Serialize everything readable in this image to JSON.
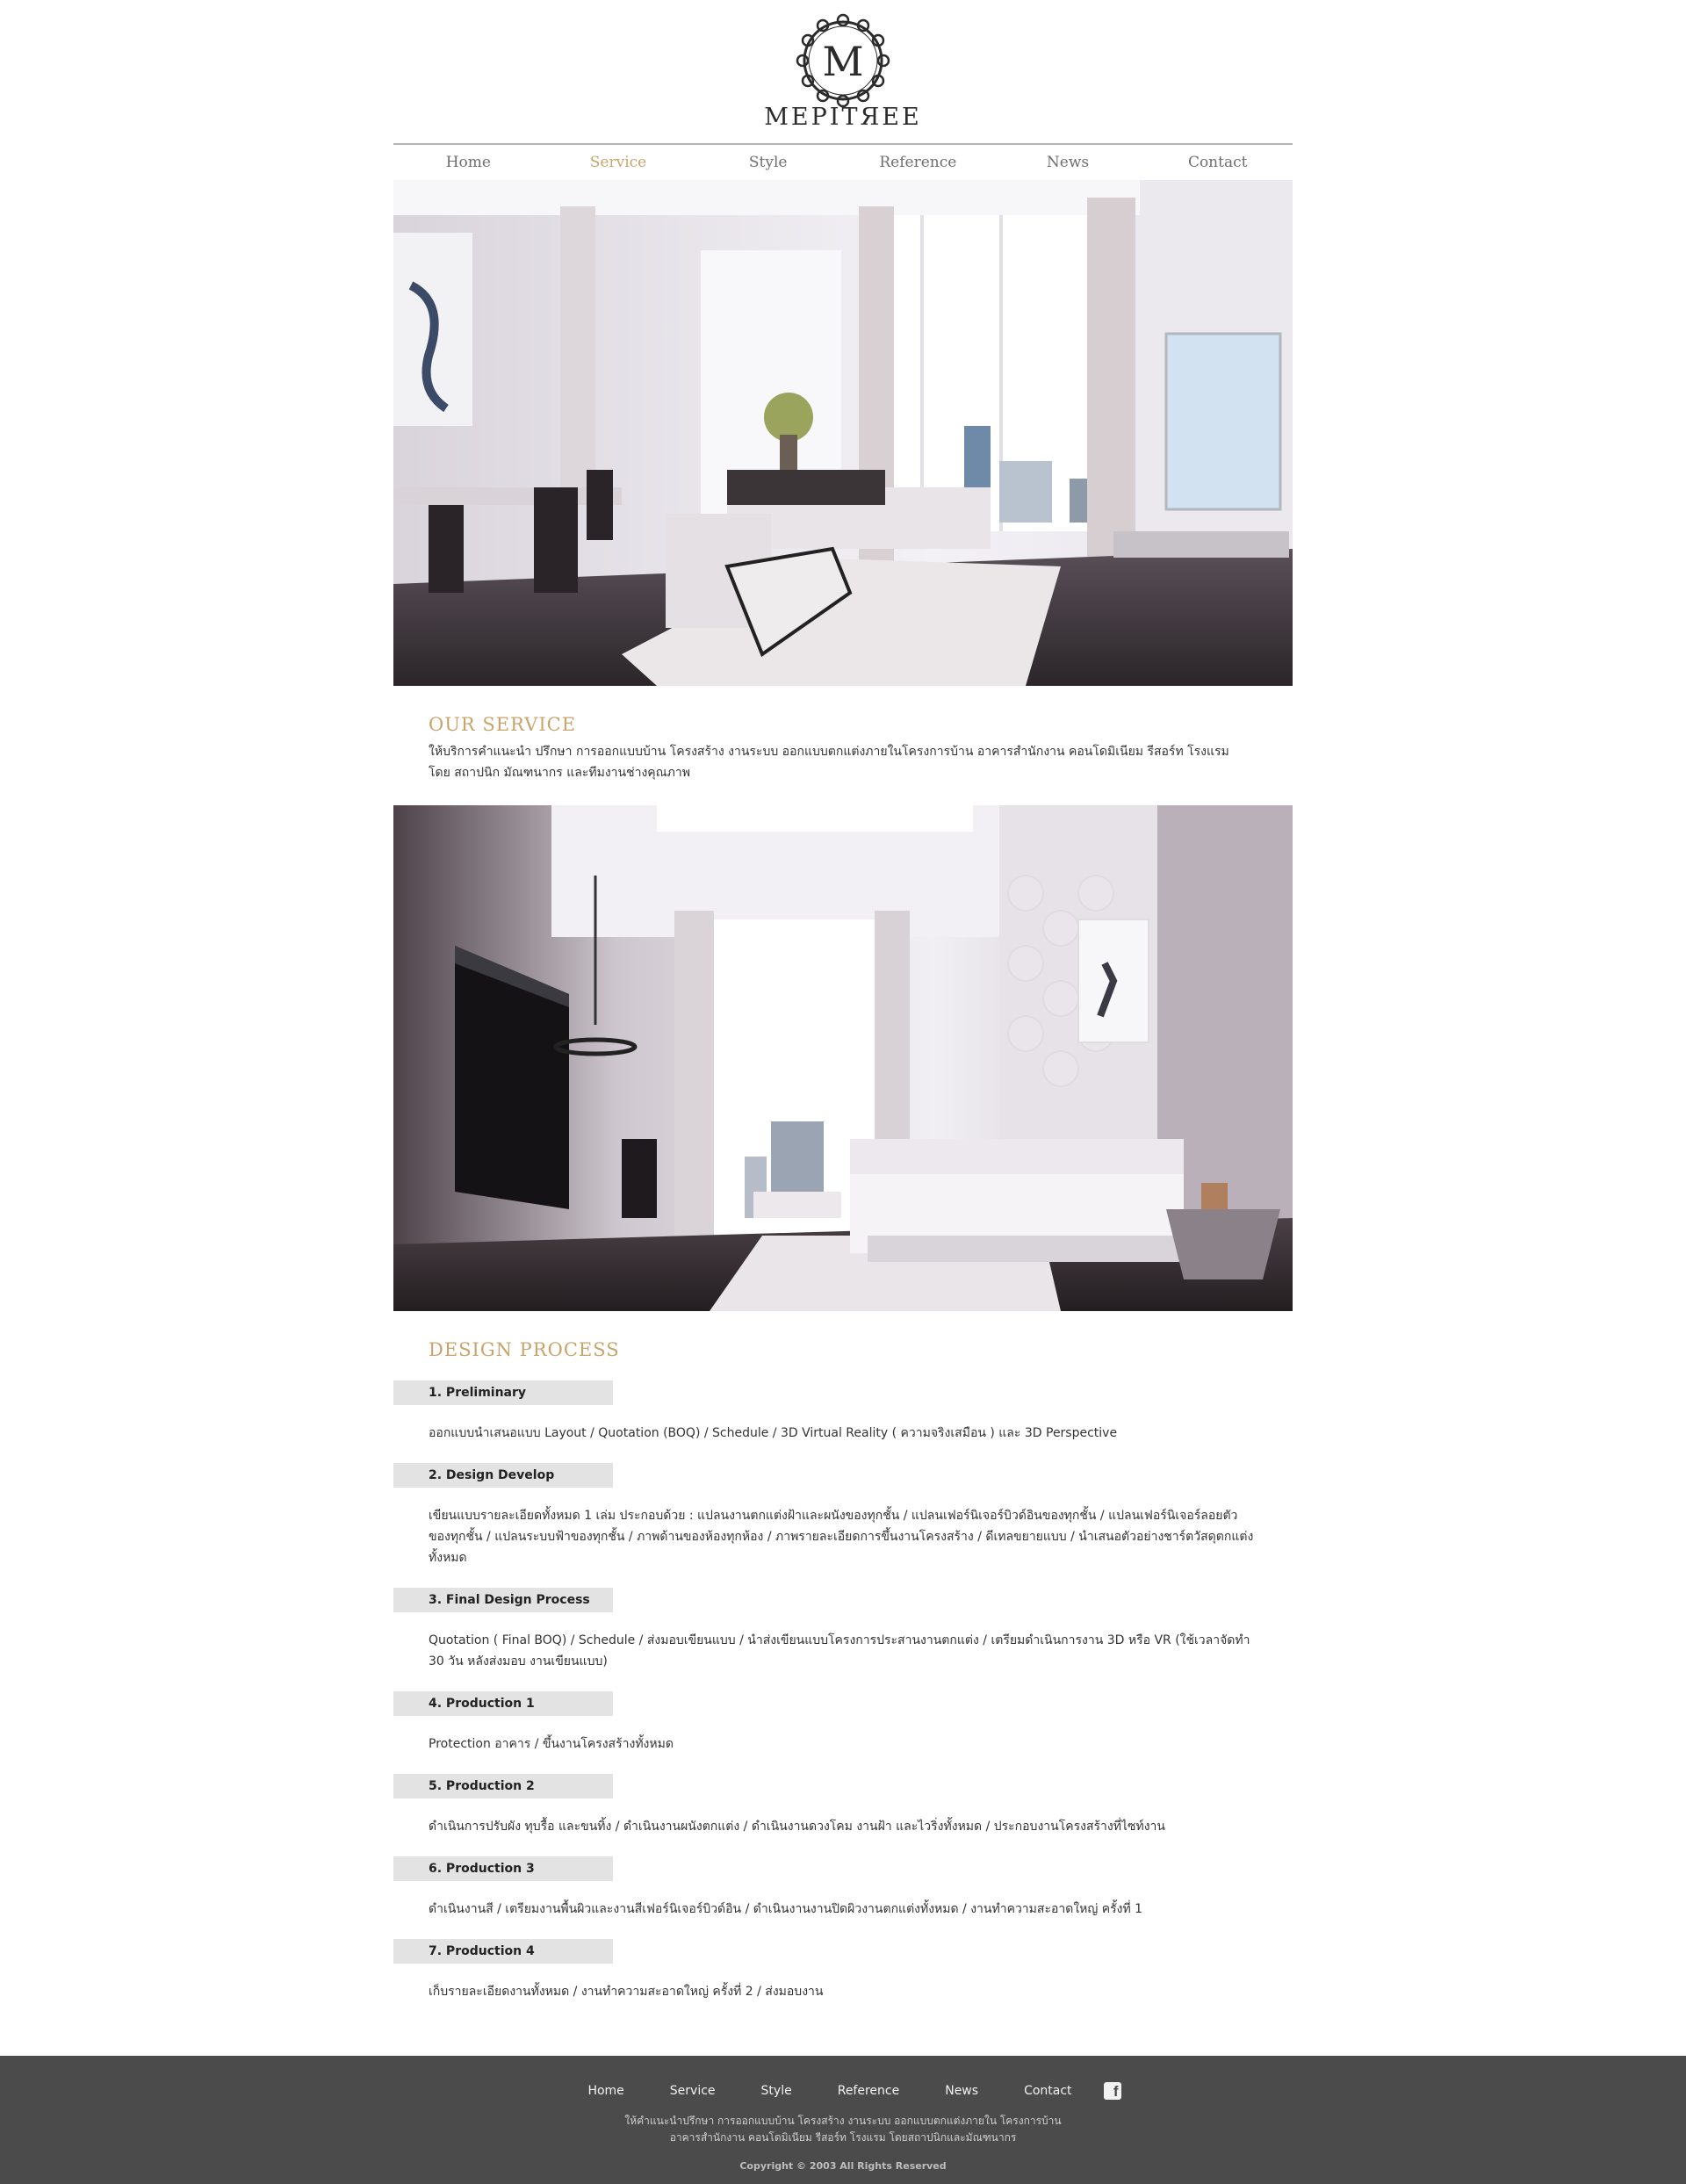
{
  "header": {
    "logo_letter": "M",
    "brand": "MEPITЯEE"
  },
  "nav": {
    "items": [
      "Home",
      "Service",
      "Style",
      "Reference",
      "News",
      "Contact"
    ],
    "active": "Service"
  },
  "our_service": {
    "title": "OUR SERVICE",
    "text": "ให้บริการคำแนะนำ ปรึกษา การออกแบบบ้าน โครงสร้าง งานระบบ ออกแบบตกแต่งภายในโครงการบ้าน อาคารสำนักงาน คอนโดมิเนียม รีสอร์ท โรงแรม โดย สถาปนิก มัณฑนากร และทีมงานช่างคุณภาพ"
  },
  "design_process": {
    "title": "DESIGN PROCESS",
    "steps": [
      {
        "label": "1. Preliminary",
        "text": "ออกแบบนำเสนอแบบ Layout / Quotation (BOQ) / Schedule / 3D Virtual Reality ( ความจริงเสมือน ) และ 3D Perspective"
      },
      {
        "label": "2. Design Develop",
        "text": "เขียนแบบรายละเอียดทั้งหมด 1 เล่ม ประกอบด้วย : แปลนงานตกแต่งฝ้าและผนังของทุกชั้น / แปลนเฟอร์นิเจอร์บิวด์อินของทุกชั้น / แปลนเฟอร์นิเจอร์ลอยตัวของทุกชั้น / แปลนระบบฟ้าของทุกชั้น / ภาพด้านของห้องทุกห้อง / ภาพรายละเอียดการขึ้นงานโครงสร้าง / ดีเทลขยายแบบ / นำเสนอตัวอย่างชาร์ตวัสดุตกแต่งทั้งหมด"
      },
      {
        "label": "3. Final Design Process",
        "text": "Quotation ( Final BOQ) / Schedule / ส่งมอบเขียนแบบ / นำส่งเขียนแบบโครงการประสานงานตกแต่ง / เตรียมดำเนินการงาน 3D หรือ VR (ใช้เวลาจัดทำ 30 วัน หลังส่งมอบ งานเขียนแบบ)"
      },
      {
        "label": "4. Production 1",
        "text": "Protection อาคาร / ขึ้นงานโครงสร้างทั้งหมด"
      },
      {
        "label": "5. Production 2",
        "text": "ดำเนินการปรับผัง ทุบรื้อ และขนทิ้ง / ดำเนินงานผนังตกแต่ง / ดำเนินงานดวงโคม งานฝ้า และไวริ่งทั้งหมด / ประกอบงานโครงสร้างที่ไซท์งาน"
      },
      {
        "label": "6. Production 3",
        "text": "ดำเนินงานสี / เตรียมงานพื้นผิวและงานสีเฟอร์นิเจอร์บิวด์อิน / ดำเนินงานงานปิดผิวงานตกแต่งทั้งหมด / งานทำความสะอาดใหญ่ ครั้งที่ 1"
      },
      {
        "label": "7. Production 4",
        "text": "เก็บรายละเอียดงานทั้งหมด / งานทำความสะอาดใหญ่ ครั้งที่ 2 / ส่งมอบงาน"
      }
    ]
  },
  "footer": {
    "links": [
      "Home",
      "Service",
      "Style",
      "Reference",
      "News",
      "Contact"
    ],
    "facebook_icon": "facebook-icon",
    "desc_line1": "ให้คำแนะนำปรึกษา การออกแบบบ้าน โครงสร้าง งานระบบ ออกแบบตกแต่งภายใน โครงการบ้าน",
    "desc_line2": "อาคารสำนักงาน คอนโดมิเนียม รีสอร์ท โรงแรม โดยสถาปนิกและมัณฑนากร",
    "copyright": "Copyright © 2003 All Rights Reserved"
  },
  "colors": {
    "accent_gold": "#c8a46b",
    "footer_bg": "#4b4b4b",
    "tab_bg": "#e3e3e3"
  }
}
